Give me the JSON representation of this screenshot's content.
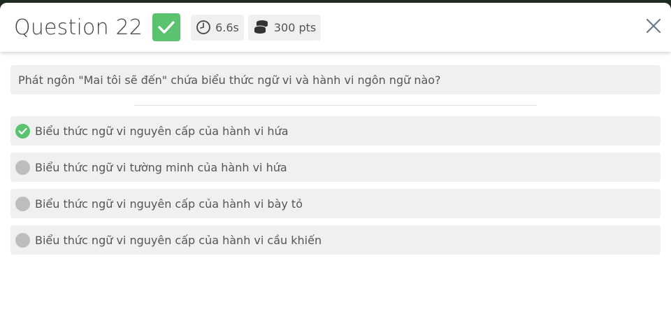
{
  "header": {
    "title": "Question 22",
    "status_icon": "check-icon",
    "time": "6.6s",
    "points": "300 pts"
  },
  "colors": {
    "correct": "#5bc36f",
    "chip_bg": "#f0f0f0",
    "neutral_dot": "#bdbdbd"
  },
  "question": {
    "text": "Phát ngôn \"Mai tôi sẽ đến\" chứa biểu thức ngữ vi và hành vi ngôn ngữ nào?"
  },
  "options": [
    {
      "label": "Biểu thức ngữ vi nguyên cấp của hành vi hứa",
      "correct": true
    },
    {
      "label": "Biểu thức ngữ vi tường minh của hành vi hứa",
      "correct": false
    },
    {
      "label": "Biểu thức ngữ vi nguyên cấp của hành vi bày tỏ",
      "correct": false
    },
    {
      "label": "Biểu thức ngữ vi nguyên cấp của hành vi cầu khiến",
      "correct": false
    }
  ]
}
